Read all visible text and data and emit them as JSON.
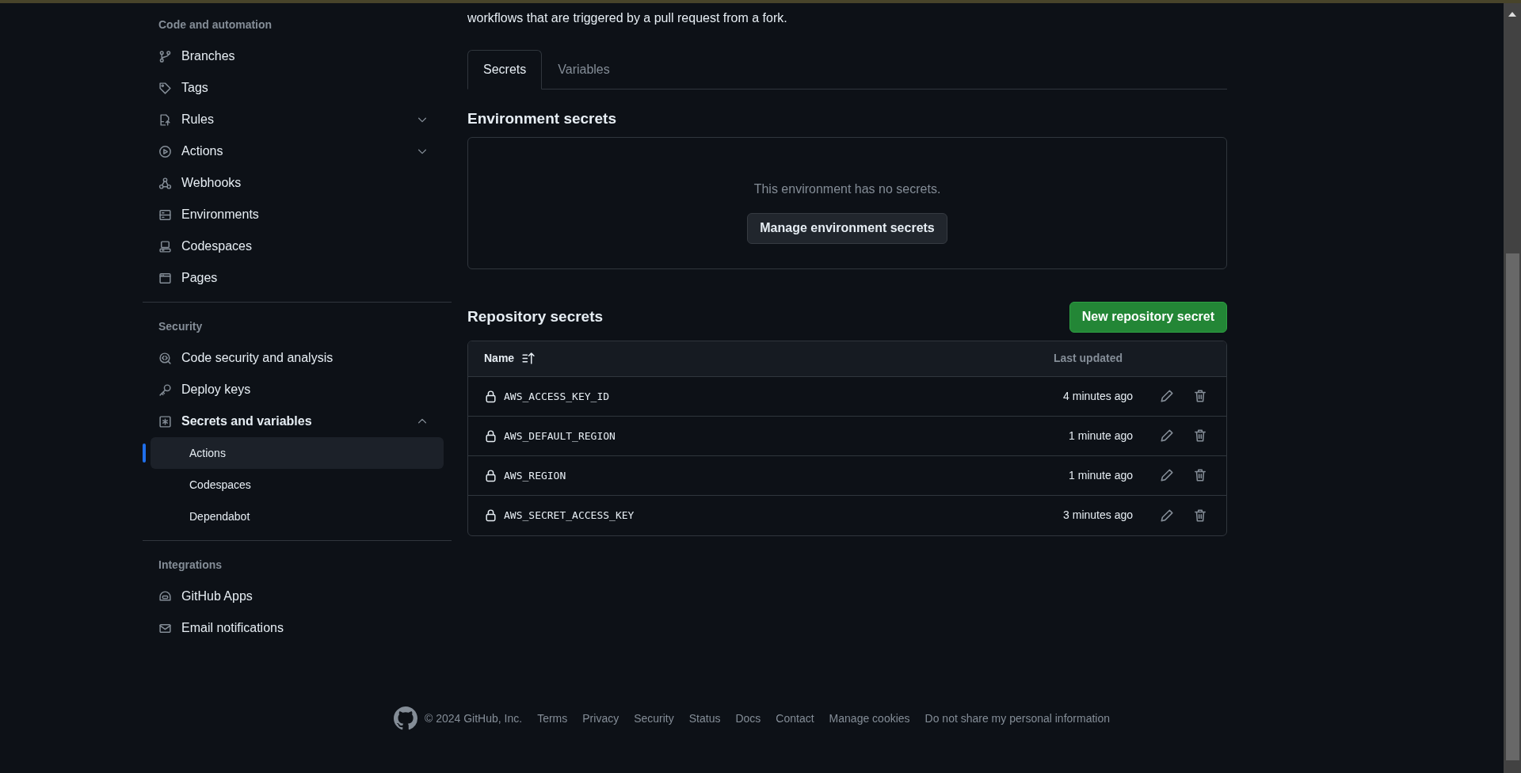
{
  "sidebar": {
    "sections": [
      {
        "heading": "Code and automation",
        "items": [
          {
            "label": "Branches",
            "selected": false
          },
          {
            "label": "Tags",
            "selected": false
          },
          {
            "label": "Rules",
            "selected": false,
            "expanded": false
          },
          {
            "label": "Actions",
            "selected": false,
            "expanded": false
          },
          {
            "label": "Webhooks",
            "selected": false
          },
          {
            "label": "Environments",
            "selected": false
          },
          {
            "label": "Codespaces",
            "selected": false
          },
          {
            "label": "Pages",
            "selected": false
          }
        ]
      },
      {
        "heading": "Security",
        "items": [
          {
            "label": "Code security and analysis",
            "selected": false
          },
          {
            "label": "Deploy keys",
            "selected": false
          },
          {
            "label": "Secrets and variables",
            "selected": false,
            "expanded": true,
            "children": [
              {
                "label": "Actions",
                "selected": true
              },
              {
                "label": "Codespaces",
                "selected": false
              },
              {
                "label": "Dependabot",
                "selected": false
              }
            ]
          }
        ]
      },
      {
        "heading": "Integrations",
        "items": [
          {
            "label": "GitHub Apps",
            "selected": false
          },
          {
            "label": "Email notifications",
            "selected": false
          }
        ]
      }
    ]
  },
  "main": {
    "intro": "workflows that are triggered by a pull request from a fork.",
    "tabs": [
      {
        "label": "Secrets",
        "selected": true
      },
      {
        "label": "Variables",
        "selected": false
      }
    ],
    "environment_secrets": {
      "title": "Environment secrets",
      "empty_text": "This environment has no secrets.",
      "button": "Manage environment secrets"
    },
    "repository_secrets": {
      "title": "Repository secrets",
      "new_button": "New repository secret",
      "columns": [
        "Name",
        "Last updated"
      ],
      "rows": [
        {
          "name": "AWS_ACCESS_KEY_ID",
          "updated": "4 minutes ago"
        },
        {
          "name": "AWS_DEFAULT_REGION",
          "updated": "1 minute ago"
        },
        {
          "name": "AWS_REGION",
          "updated": "1 minute ago"
        },
        {
          "name": "AWS_SECRET_ACCESS_KEY",
          "updated": "3 minutes ago"
        }
      ]
    }
  },
  "footer": {
    "copyright": "© 2024 GitHub, Inc.",
    "links": [
      "Terms",
      "Privacy",
      "Security",
      "Status",
      "Docs",
      "Contact",
      "Manage cookies",
      "Do not share my personal information"
    ]
  }
}
